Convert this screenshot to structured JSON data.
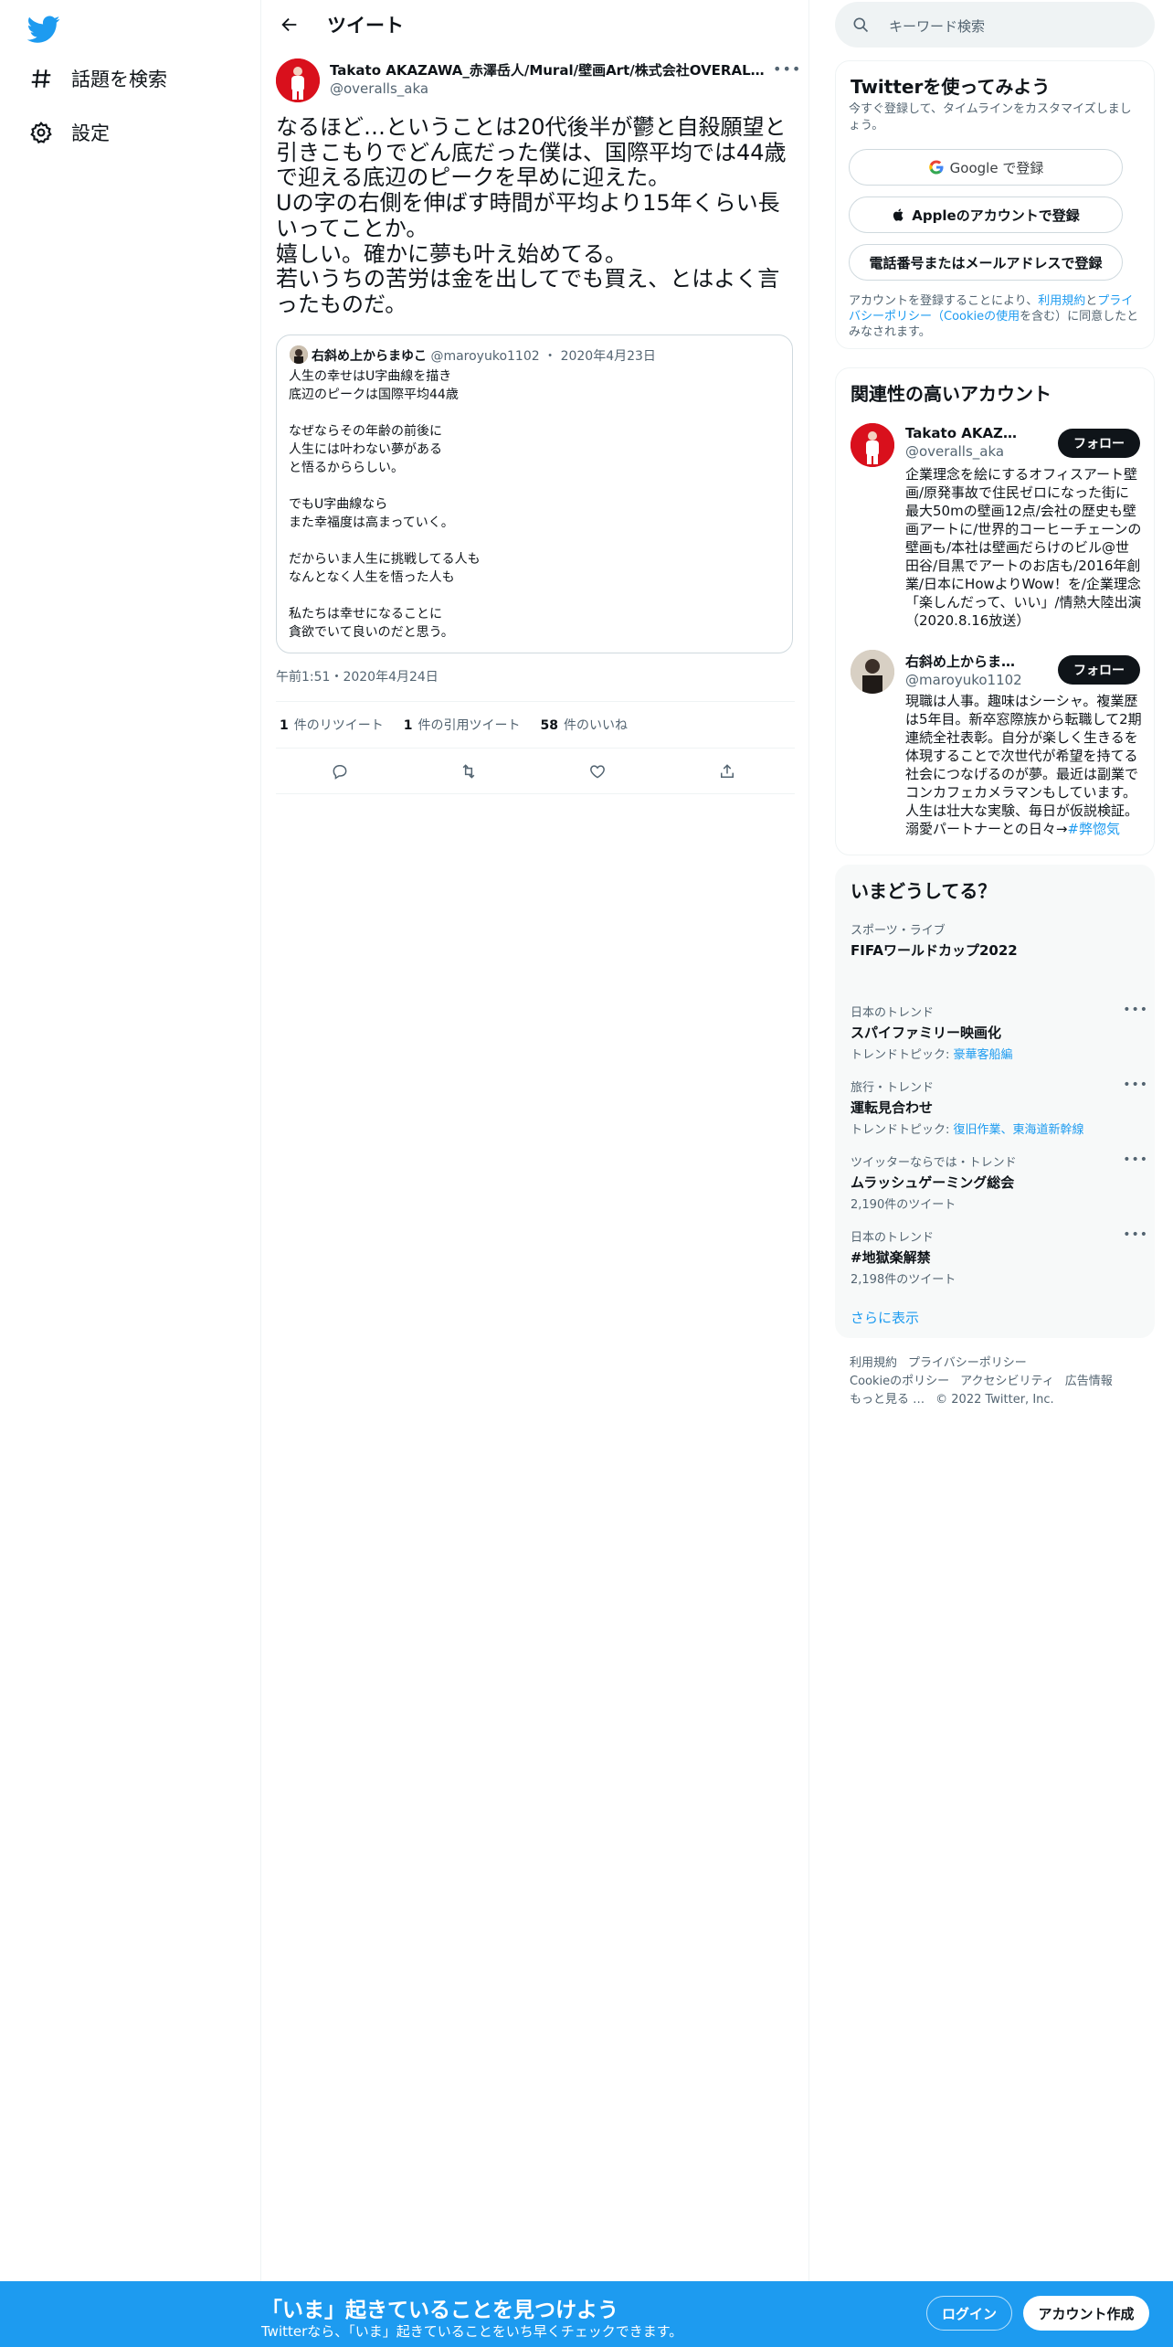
{
  "nav": {
    "logo_icon": "twitter-bird-icon",
    "items": [
      {
        "label": "話題を検索",
        "icon": "hashtag-icon"
      },
      {
        "label": "設定",
        "icon": "gear-icon"
      }
    ]
  },
  "header": {
    "title": "ツイート"
  },
  "tweet": {
    "author_name": "Takato AKAZAWA_赤澤岳人/Mural/壁画Art/株式会社OVERALLs代表/…",
    "author_handle": "@overalls_aka",
    "text": "なるほど…ということは20代後半が鬱と自殺願望と引きこもりでどん底だった僕は、国際平均では44歳で迎える底辺のピークを早めに迎えた。\nUの字の右側を伸ばす時間が平均より15年くらい長いってことか。\n嬉しい。確かに夢も叶え始めてる。\n若いうちの苦労は金を出してでも買え、とはよく言ったものだ。",
    "time": "午前1:51・2020年4月24日",
    "stats": [
      {
        "count": "1",
        "label": "件のリツイート"
      },
      {
        "count": "1",
        "label": "件の引用ツイート"
      },
      {
        "count": "58",
        "label": "件のいいね"
      }
    ],
    "quote": {
      "name": "右斜め上からまゆこ",
      "handle": "@maroyuko1102",
      "date": "2020年4月23日",
      "text": "人生の幸せはU字曲線を描き\n底辺のピークは国際平均44歳\n\nなぜならその年齢の前後に\n人生には叶わない夢がある\nと悟るかららしい。\n\nでもU字曲線なら\nまた幸福度は高まっていく。\n\nだからいま人生に挑戦してる人も\nなんとなく人生を悟った人も\n\n私たちは幸せになることに\n貪欲でいて良いのだと思う。"
    }
  },
  "search": {
    "placeholder": "キーワード検索"
  },
  "signup_card": {
    "title": "Twitterを使ってみよう",
    "subtitle": "今すぐ登録して、タイムラインをカスタマイズしましょう。",
    "google_label": "Google で登録",
    "apple_label": "Appleのアカウントで登録",
    "phone_label": "電話番号またはメールアドレスで登録",
    "tos_prefix": "アカウントを登録することにより、",
    "tos_link1": "利用規約",
    "tos_mid": "と",
    "tos_link2": "プライバシーポリシー（Cookieの使用",
    "tos_suffix": "を含む）に同意したとみなされます。"
  },
  "related": {
    "title": "関連性の高いアカウント",
    "accounts": [
      {
        "name": "Takato AKAZAWA_赤澤岳人",
        "handle": "@overalls_aka",
        "follow": "フォロー",
        "bio": "企業理念を絵にするオフィスアート壁画/原発事故で住民ゼロになった街に最大50mの壁画12点/会社の歴史も壁画アートに/世界的コーヒーチェーンの壁画も/本社は壁画だらけのビル@世田谷/目黒でアートのお店も/2016年創業/日本にHowよりWow！を/企業理念「楽しんだって、いい」/情熱大陸出演（2020.8.16放送）"
      },
      {
        "name": "右斜め上からまゆこ",
        "handle": "@maroyuko1102",
        "follow": "フォロー",
        "bio": "現職は人事。趣味はシーシャ。複業歴は5年目。新卒窓際族から転職して2期連続全社表彰。自分が楽しく生きるを体現することで次世代が希望を持てる社会につなげるのが夢。最近は副業でコンカフェカメラマンもしています。人生は壮大な実験、毎日が仮説検証。溺愛パートナーとの日々→",
        "bio_link": "#弊惚気"
      }
    ]
  },
  "trends": {
    "title": "いまどうしてる？",
    "items": [
      {
        "category": "スポーツ・ライブ",
        "name": "FIFAワールドカップ2022",
        "sub": ""
      },
      {
        "category": "日本のトレンド",
        "name": "スパイファミリー映画化",
        "sub_prefix": "トレンドトピック: ",
        "sub_links": "豪華客船編"
      },
      {
        "category": "旅行・トレンド",
        "name": "運転見合わせ",
        "sub_prefix": "トレンドトピック: ",
        "sub_links": "復旧作業、東海道新幹線"
      },
      {
        "category": "ツイッターならでは・トレンド",
        "name": "ムラッシュゲーミング総会",
        "sub": "2,190件のツイート"
      },
      {
        "category": "日本のトレンド",
        "name": "#地獄楽解禁",
        "sub": "2,198件のツイート"
      }
    ],
    "show_more": "さらに表示"
  },
  "footer": {
    "row1": [
      "利用規約",
      "プライバシーポリシー"
    ],
    "row2": [
      "Cookieのポリシー",
      "アクセシビリティ",
      "広告情報"
    ],
    "more": "もっと見る …",
    "copyright": "© 2022 Twitter, Inc."
  },
  "bottom_bar": {
    "title": "「いま」起きていることを見つけよう",
    "subtitle": "Twitterなら、「いま」起きていることをいち早くチェックできます。",
    "login": "ログイン",
    "signup": "アカウント作成"
  },
  "colors": {
    "accent": "#1d9bf0",
    "text": "#0f1419",
    "muted": "#536471",
    "border": "#eff3f4"
  }
}
